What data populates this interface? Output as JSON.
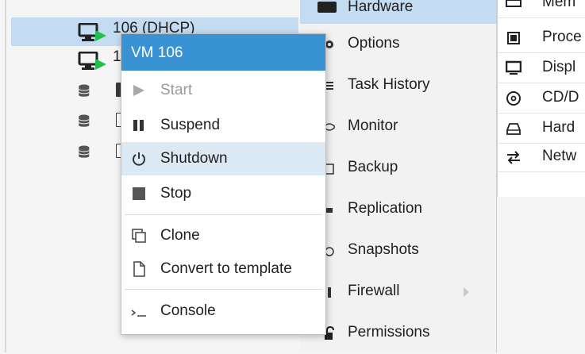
{
  "tree": {
    "items": [
      {
        "label": "106 (DHCP)",
        "type": "vm-running",
        "selected": true
      },
      {
        "label": "1",
        "type": "vm-running"
      },
      {
        "label": "",
        "type": "storage"
      },
      {
        "label": "",
        "type": "storage"
      },
      {
        "label": "",
        "type": "storage"
      }
    ]
  },
  "nav": {
    "items": [
      {
        "label": "Hardware",
        "icon": "hardware-icon"
      },
      {
        "label": "Options",
        "icon": "gear-icon"
      },
      {
        "label": "Task History",
        "icon": "list-icon"
      },
      {
        "label": "Monitor",
        "icon": "eye-icon"
      },
      {
        "label": "Backup",
        "icon": "floppy-icon"
      },
      {
        "label": "Replication",
        "icon": "retweet-icon"
      },
      {
        "label": "Snapshots",
        "icon": "history-icon"
      },
      {
        "label": "Firewall",
        "icon": "shield-icon"
      },
      {
        "label": "Permissions",
        "icon": "unlock-icon"
      }
    ]
  },
  "hardware": {
    "items": [
      {
        "label": "Mem",
        "icon": "memory-icon"
      },
      {
        "label": "Proce",
        "icon": "cpu-icon"
      },
      {
        "label": "Displ",
        "icon": "display-icon"
      },
      {
        "label": "CD/D",
        "icon": "cdrom-icon"
      },
      {
        "label": "Hard",
        "icon": "hdd-icon"
      },
      {
        "label": "Netw",
        "icon": "network-icon"
      }
    ]
  },
  "context_menu": {
    "title": "VM 106",
    "items": [
      {
        "label": "Start",
        "icon": "play-icon",
        "disabled": true
      },
      {
        "label": "Suspend",
        "icon": "pause-icon"
      },
      {
        "label": "Shutdown",
        "icon": "power-icon",
        "highlighted": true
      },
      {
        "label": "Stop",
        "icon": "stop-icon"
      },
      {
        "label": "Clone",
        "icon": "clone-icon"
      },
      {
        "label": "Convert to template",
        "icon": "file-icon"
      },
      {
        "label": "Console",
        "icon": "terminal-icon"
      }
    ]
  },
  "colors": {
    "accent": "#3892d3",
    "selection": "#c4dcf1",
    "hover": "#dbe9f5",
    "running": "#21bf4b"
  }
}
